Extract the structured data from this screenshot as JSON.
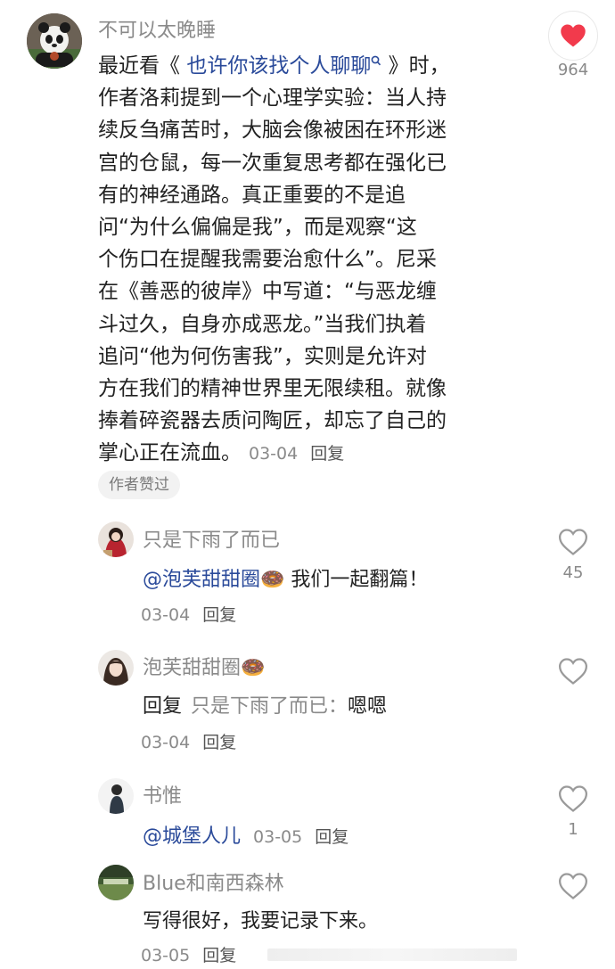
{
  "main_comment": {
    "author": "不可以太晚睡",
    "likes": "964",
    "text_before_link": "最近看《 ",
    "book_link": "也许你该找个人聊聊",
    "text_after_link": " 》时，",
    "lines": [
      "作者洛莉提到一个心理学实验：当人持",
      "续反刍痛苦时，大脑会像被困在环形迷",
      "宫的仓鼠，每一次重复思考都在强化已",
      "有的神经通路。真正重要的不是追",
      "问“为什么偏偏是我”，而是观察“这",
      "个伤口在提醒我需要治愈什么”。尼采",
      "在《善恶的彼岸》中写道：“与恶龙缠",
      "斗过久，自身亦成恶龙。”当我们执着",
      "追问“他为何伤害我”，实则是允许对",
      "方在我们的精神世界里无限续租。就像",
      "捧着碎瓷器去质问陶匠，却忘了自己的"
    ],
    "last_line": "掌心正在流血。",
    "date": "03-04",
    "reply_label": "回复",
    "badge": "作者赞过",
    "colors": {
      "heart": "#f23a4c",
      "link": "#2a4a9a"
    }
  },
  "replies": [
    {
      "author": "只是下雨了而已",
      "mention": "@泡芙甜甜圈",
      "emoji": "🍩",
      "text": " 我们一起翻篇！",
      "date": "03-04",
      "reply_label": "回复",
      "likes": "45"
    },
    {
      "author": "泡芙甜甜圈",
      "emoji": "🍩",
      "prefix": "回复",
      "target": "只是下雨了而已：",
      "text": "嗯嗯",
      "date": "03-04",
      "reply_label": "回复",
      "likes": ""
    },
    {
      "author": "书惟",
      "mention": "@城堡人儿",
      "date": "03-05",
      "reply_label": "回复",
      "likes": "1"
    },
    {
      "author": "Blue和南西森林",
      "text": "写得很好，我要记录下来。",
      "date": "03-05",
      "reply_label": "回复",
      "likes": ""
    }
  ]
}
